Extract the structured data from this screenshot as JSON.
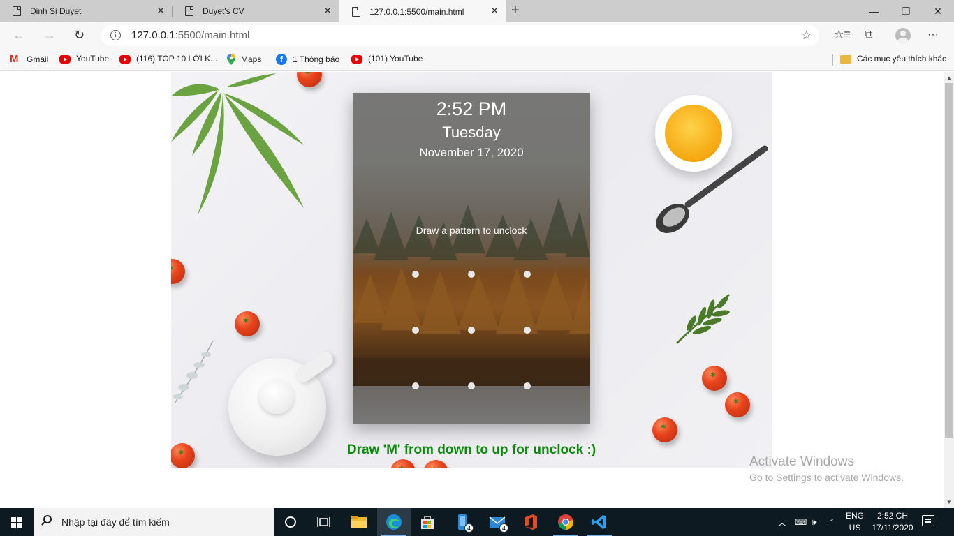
{
  "browser": {
    "tabs": [
      {
        "title": "Dinh Si Duyet",
        "active": false
      },
      {
        "title": "Duyet's CV",
        "active": false
      },
      {
        "title": "127.0.0.1:5500/main.html",
        "active": true
      }
    ],
    "address": {
      "host": "127.0.0.1",
      "rest": ":5500/main.html"
    },
    "bookmarks": [
      {
        "label": "Gmail",
        "icon": "gmail-icon"
      },
      {
        "label": "YouTube",
        "icon": "youtube-icon"
      },
      {
        "label": "(116) TOP 10 LỜI K...",
        "icon": "youtube-icon"
      },
      {
        "label": "Maps",
        "icon": "maps-icon"
      },
      {
        "label": "1 Thông báo",
        "icon": "facebook-icon"
      },
      {
        "label": "(101) YouTube",
        "icon": "youtube-icon"
      }
    ],
    "other_favorites": "Các mục yêu thích khác"
  },
  "lockscreen": {
    "time": "2:52 PM",
    "day": "Tuesday",
    "date": "November 17, 2020",
    "hint": "Draw a pattern to unclock",
    "dot_count": 9
  },
  "page": {
    "caption": "Draw 'M' from down to up for unclock :)",
    "caption_color": "#0b8a0b"
  },
  "watermark": {
    "title": "Activate Windows",
    "subtitle": "Go to Settings to activate Windows."
  },
  "taskbar": {
    "search_placeholder": "Nhập tại đây để tìm kiếm",
    "lang_line1": "ENG",
    "lang_line2": "US",
    "clock_time": "2:52 CH",
    "clock_date": "17/11/2020",
    "badges": {
      "phone": "4",
      "mail": "4"
    }
  }
}
